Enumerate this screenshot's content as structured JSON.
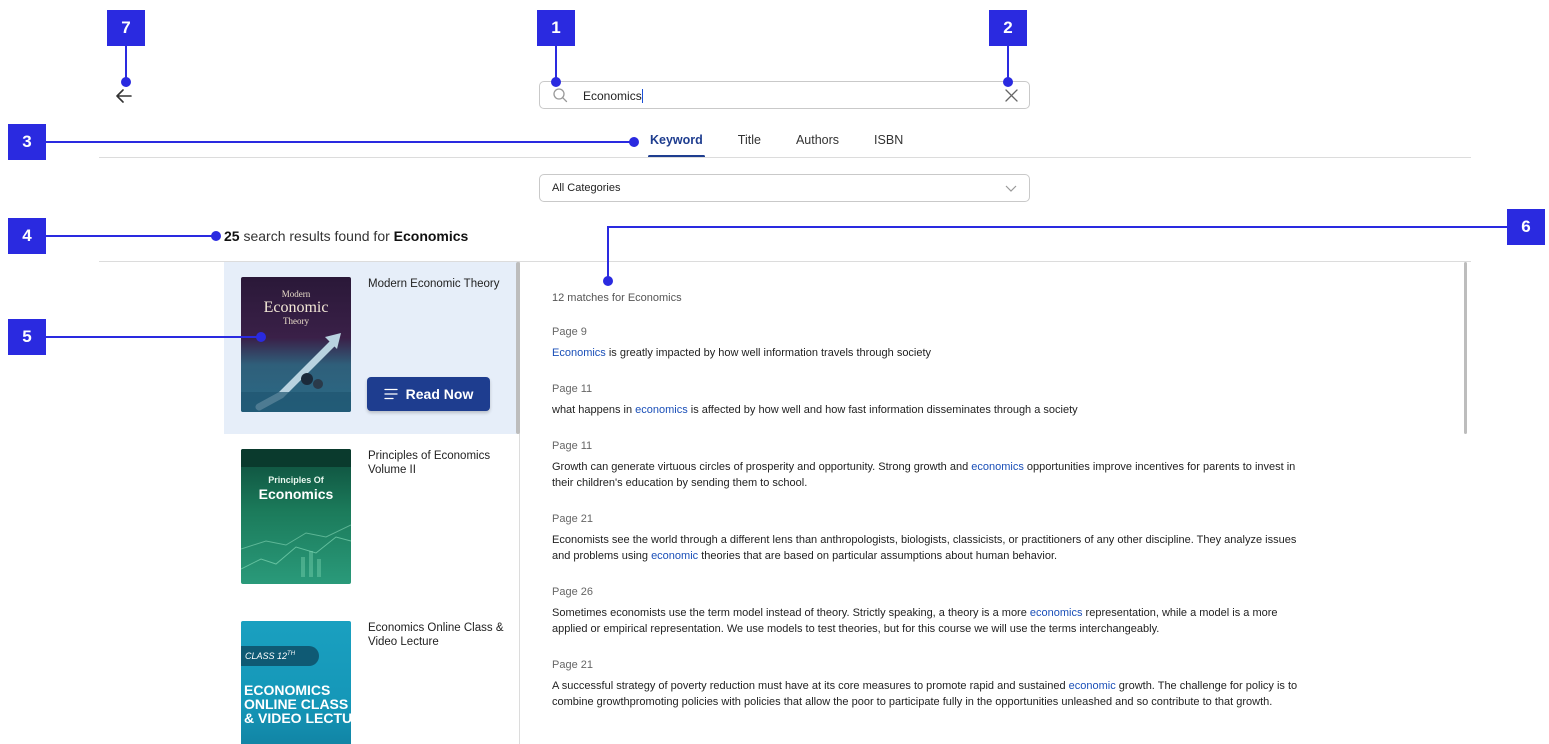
{
  "callouts": [
    "1",
    "2",
    "3",
    "4",
    "5",
    "6",
    "7"
  ],
  "search": {
    "value": "Economics",
    "placeholder": ""
  },
  "tabs": [
    {
      "label": "Keyword",
      "active": true
    },
    {
      "label": "Title",
      "active": false
    },
    {
      "label": "Authors",
      "active": false
    },
    {
      "label": "ISBN",
      "active": false
    }
  ],
  "category": {
    "selected": "All Categories"
  },
  "summary": {
    "count": "25",
    "text": " search results found for ",
    "term": "Economics"
  },
  "results": [
    {
      "title": "Modern Economic Theory",
      "cover": {
        "top": "Modern",
        "main": "Economic",
        "sub": "Theory"
      },
      "read_label": "Read Now",
      "selected": true
    },
    {
      "title": "Principles of Economics Volume II",
      "cover": {
        "top": "Principles Of",
        "main": "Economics"
      },
      "selected": false
    },
    {
      "title": "Economics Online Class & Video Lecture",
      "cover": {
        "badge": "CLASS 12",
        "badge_sup": "TH",
        "l1": "ECONOMICS",
        "l2": "ONLINE CLASS",
        "l3": "& VIDEO LECTU"
      },
      "selected": false
    }
  ],
  "matches": {
    "count_label": "12 matches for Economics",
    "items": [
      {
        "page": "Page 9",
        "before": "",
        "hl": "Economics",
        "after": " is greatly impacted by how well information travels through society"
      },
      {
        "page": "Page 11",
        "before": "what happens in ",
        "hl": "economics",
        "after": " is affected by how well and how fast information disseminates through a society"
      },
      {
        "page": "Page 11",
        "before": "Growth can generate virtuous circles of prosperity and opportunity. Strong growth and ",
        "hl": "economics",
        "after": " opportunities improve incentives for parents to invest in their children's education by sending them to school."
      },
      {
        "page": "Page 21",
        "before": "Economists see the world through a different lens than anthropologists, biologists, classicists, or practitioners of any other discipline. They analyze issues and problems using ",
        "hl": "economic",
        "after": " theories that are based on particular assumptions about human behavior."
      },
      {
        "page": "Page 26",
        "before": "Sometimes economists use the term model instead of theory. Strictly speaking, a theory is a more ",
        "hl": "economics",
        "after": "  representation, while a model is a more applied or empirical representation. We use models to test theories, but for this course we will use the terms interchangeably."
      },
      {
        "page": "Page 21",
        "before": "A successful strategy of poverty reduction must have at its core measures to promote rapid and sustained ",
        "hl": "economic",
        "after": " growth. The challenge for policy is to combine growthpromoting policies with policies that allow the poor to participate fully in the opportunities unleashed and so contribute to that growth."
      }
    ]
  },
  "colors": {
    "accent": "#1e3d8f",
    "callout": "#2a2ae0",
    "highlight": "#1a4fb8",
    "selected_bg": "#e6eef9"
  },
  "icons": {
    "back": "arrow-left-icon",
    "search": "search-icon",
    "clear": "close-icon",
    "dropdown": "chevron-down-icon",
    "read": "menu-lines-icon"
  }
}
